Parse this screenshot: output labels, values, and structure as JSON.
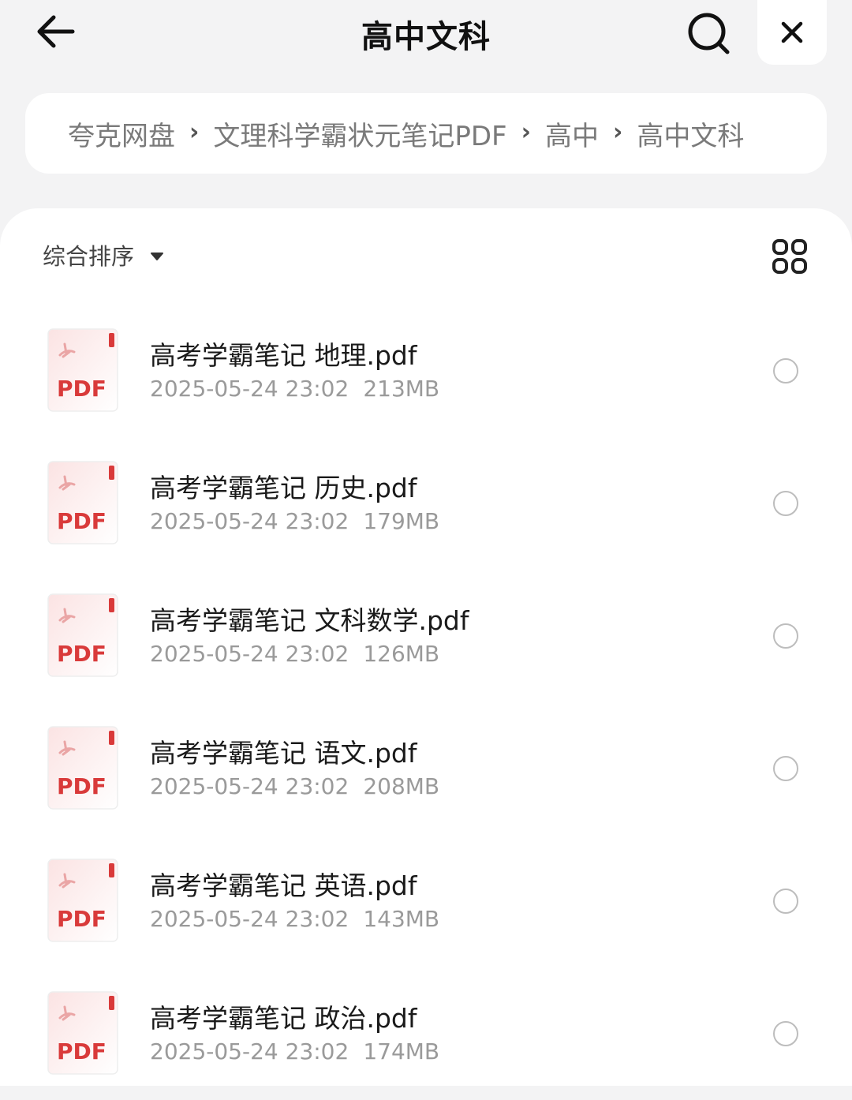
{
  "header": {
    "title": "高中文科"
  },
  "breadcrumb": {
    "items": [
      "夸克网盘",
      "文理科学霸状元笔记PDF",
      "高中",
      "高中文科"
    ],
    "separator": "›"
  },
  "toolbar": {
    "sort_label": "综合排序"
  },
  "files": [
    {
      "name": "高考学霸笔记 地理.pdf",
      "date": "2025-05-24 23:02",
      "size": "213MB",
      "type_label": "PDF"
    },
    {
      "name": "高考学霸笔记 历史.pdf",
      "date": "2025-05-24 23:02",
      "size": "179MB",
      "type_label": "PDF"
    },
    {
      "name": "高考学霸笔记 文科数学.pdf",
      "date": "2025-05-24 23:02",
      "size": "126MB",
      "type_label": "PDF"
    },
    {
      "name": "高考学霸笔记 语文.pdf",
      "date": "2025-05-24 23:02",
      "size": "208MB",
      "type_label": "PDF"
    },
    {
      "name": "高考学霸笔记 英语.pdf",
      "date": "2025-05-24 23:02",
      "size": "143MB",
      "type_label": "PDF"
    },
    {
      "name": "高考学霸笔记 政治.pdf",
      "date": "2025-05-24 23:02",
      "size": "174MB",
      "type_label": "PDF"
    }
  ],
  "icons": {
    "back": "arrow-left-icon",
    "search": "search-icon",
    "close": "close-icon",
    "sort": "caret-down-icon",
    "view": "grid-view-icon",
    "file": "pdf-file-icon"
  },
  "colors": {
    "pdf_red": "#d93a3a",
    "pdf_bg": "#fdf0f0",
    "background": "#f3f3f4"
  }
}
